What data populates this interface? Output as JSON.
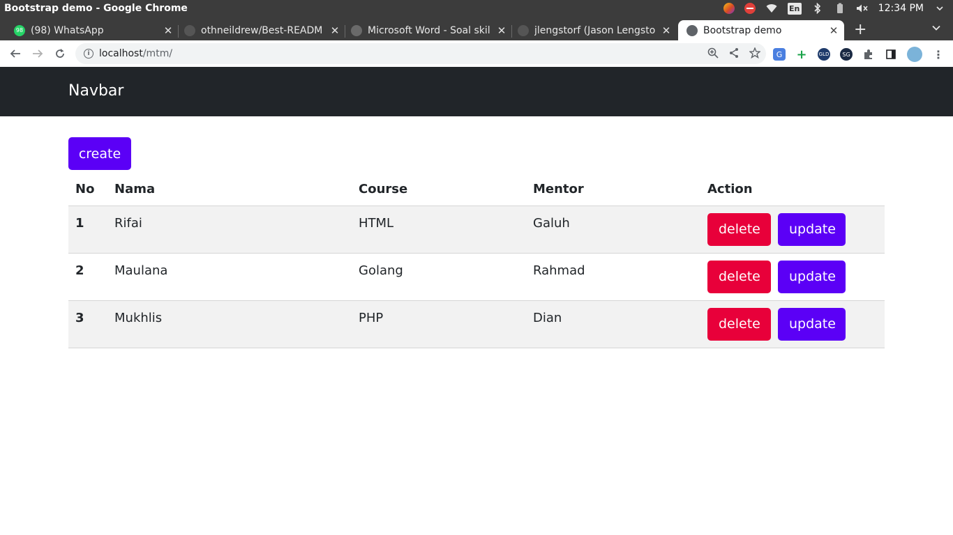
{
  "os": {
    "window_title": "Bootstrap demo - Google Chrome",
    "language": "En",
    "clock": "12:34 PM"
  },
  "tabs": [
    {
      "label": "(98) WhatsApp",
      "icon": "whatsapp-icon"
    },
    {
      "label": "othneildrew/Best-READM",
      "icon": "github-icon"
    },
    {
      "label": "Microsoft Word - Soal skil",
      "icon": "globe-icon"
    },
    {
      "label": "jlengstorf (Jason Lengsto",
      "icon": "github-icon"
    },
    {
      "label": "Bootstrap demo",
      "icon": "globe-icon",
      "active": true
    }
  ],
  "address_bar": {
    "host": "localhost",
    "path": "/mtm/"
  },
  "page": {
    "navbar_brand": "Navbar",
    "create_label": "create",
    "columns": [
      "No",
      "Nama",
      "Course",
      "Mentor",
      "Action"
    ],
    "rows": [
      {
        "no": "1",
        "nama": "Rifai",
        "course": "HTML",
        "mentor": "Galuh",
        "delete": "delete",
        "update": "update"
      },
      {
        "no": "2",
        "nama": "Maulana",
        "course": "Golang",
        "mentor": "Rahmad",
        "delete": "delete",
        "update": "update"
      },
      {
        "no": "3",
        "nama": "Mukhlis",
        "course": "PHP",
        "mentor": "Dian",
        "delete": "delete",
        "update": "update"
      }
    ]
  },
  "colors": {
    "primary": "#5b00f6",
    "danger": "#e8003a",
    "navbar": "#212529"
  }
}
